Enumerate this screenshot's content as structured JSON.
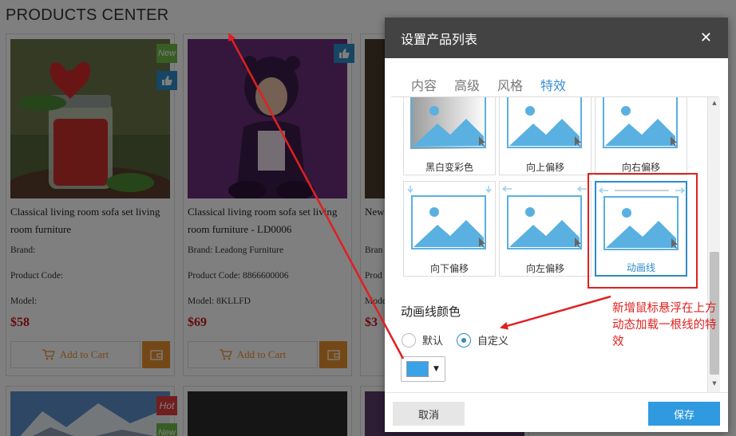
{
  "page": {
    "title": "PRODUCTS CENTER",
    "products": [
      {
        "name": "Classical living room sofa set living room furniture",
        "brand": "Brand:",
        "code": "Product Code:",
        "model": "Model:",
        "price": "$58",
        "cart": "Add to Cart",
        "badges": [
          "New",
          "like"
        ]
      },
      {
        "name": "Classical living room sofa set living room furniture - LD0006",
        "brand": "Brand: Leadong Furniture",
        "code": "Product Code: 8866600006",
        "model": "Model: 8KLLFD",
        "price": "$69",
        "cart": "Add to Cart",
        "badges": [
          "like"
        ]
      },
      {
        "name": "New",
        "brand": "Bran",
        "code": "Prod",
        "model": "Mode",
        "price": "$3"
      }
    ],
    "row2_badges": [
      "Hot",
      "New"
    ]
  },
  "dialog": {
    "title": "设置产品列表",
    "close_icon": "close-icon",
    "tabs": [
      {
        "label": "内容",
        "active": false
      },
      {
        "label": "高级",
        "active": false
      },
      {
        "label": "风格",
        "active": false
      },
      {
        "label": "特效",
        "active": true
      }
    ],
    "effects": [
      {
        "label": "黑白变彩色",
        "selected": false
      },
      {
        "label": "向上偏移",
        "selected": false
      },
      {
        "label": "向右偏移",
        "selected": false
      },
      {
        "label": "向下偏移",
        "selected": false
      },
      {
        "label": "向左偏移",
        "selected": false
      },
      {
        "label": "动画线",
        "selected": true
      }
    ],
    "section_title": "动画线颜色",
    "radio_default": "默认",
    "radio_custom": "自定义",
    "radio_selected": "custom",
    "color_value": "#3aa3e8",
    "cancel_label": "取消",
    "save_label": "保存"
  },
  "annotation": {
    "text": "新增鼠标悬浮在上方动态加载一根线的特效",
    "color": "#e02020"
  },
  "colors": {
    "accent": "#2f8bc9",
    "save": "#2f9ae0",
    "price": "#c8161d",
    "cart": "#e8912c"
  }
}
